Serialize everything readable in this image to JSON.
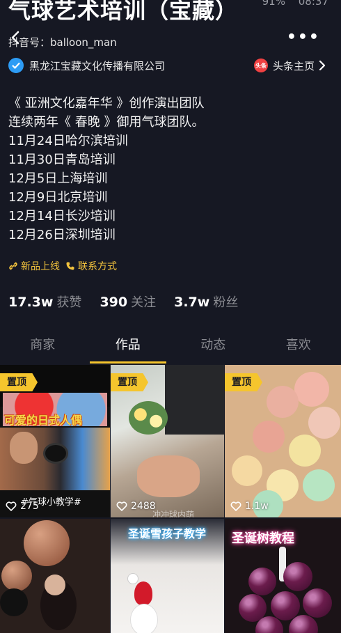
{
  "status_bar": {
    "battery": "91%",
    "time": "08:37"
  },
  "profile": {
    "name": "气球艺术培训（宝藏）",
    "douyin_id": "抖音号：balloon_man",
    "verified_org": "黑龙江宝藏文化传播有限公司",
    "toutiao_badge": "头条",
    "toutiao_label": "头条主页"
  },
  "bio": {
    "lines": [
      "《 亚洲文化嘉年华 》创作演出团队",
      "连续两年《 春晚 》御用气球团队。",
      "11月24日哈尔滨培训",
      "11月30日青岛培训",
      "12月5日上海培训",
      "12月9日北京培训",
      "12月14日长沙培训",
      "12月26日深圳培训"
    ]
  },
  "links": {
    "new_launch": "新品上线",
    "contact": "联系方式"
  },
  "stats": [
    {
      "num": "17.3w",
      "label": "获赞"
    },
    {
      "num": "390",
      "label": "关注"
    },
    {
      "num": "3.7w",
      "label": "粉丝"
    }
  ],
  "tabs": [
    {
      "label": "商家",
      "active": false
    },
    {
      "label": "作品",
      "active": true
    },
    {
      "label": "动态",
      "active": false
    },
    {
      "label": "喜欢",
      "active": false
    }
  ],
  "videos": [
    {
      "pinned": "置顶",
      "likes": "275",
      "overlay": "可爱的日式人偶",
      "tag": "#气球小教学#"
    },
    {
      "pinned": "置顶",
      "likes": "2488",
      "watermark": "冲冲球内萌"
    },
    {
      "pinned": "置顶",
      "likes": "1.1w"
    },
    {
      "overlay": ""
    },
    {
      "overlay": "圣诞雪孩子教学"
    },
    {
      "overlay": "圣诞树教程"
    }
  ],
  "colors": {
    "background": "#161823",
    "accent": "#f5c52d",
    "verified": "#2d9cf5",
    "toutiao": "#f04142",
    "link": "#f3c33d"
  }
}
